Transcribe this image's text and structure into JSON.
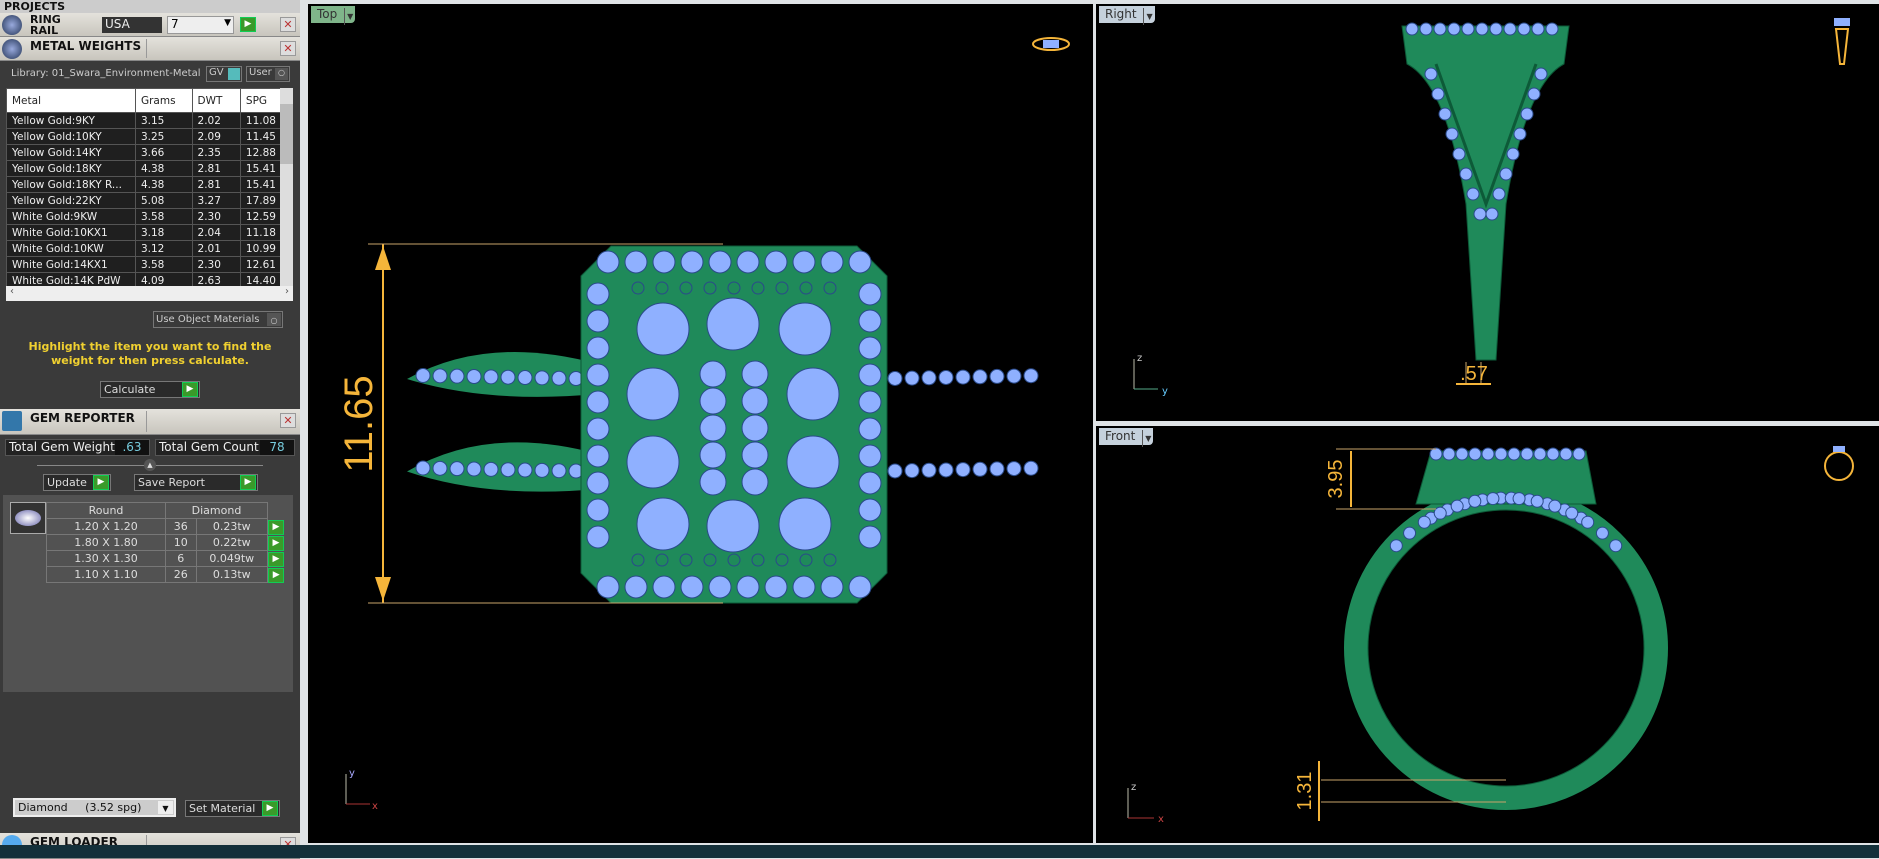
{
  "panels": {
    "projects": "PROJECTS",
    "ring_rail": {
      "title": "RING RAIL",
      "country": "USA",
      "size": "7"
    },
    "metal_weights": {
      "title": "METAL WEIGHTS",
      "library": "Library: 01_Swara_Environment-Metal",
      "gv_label": "GV",
      "user_label": "User",
      "columns": [
        "Metal",
        "Grams",
        "DWT",
        "SPG"
      ],
      "rows": [
        [
          "Yellow Gold:9KY",
          "3.15",
          "2.02",
          "11.08"
        ],
        [
          "Yellow Gold:10KY",
          "3.25",
          "2.09",
          "11.45"
        ],
        [
          "Yellow Gold:14KY",
          "3.66",
          "2.35",
          "12.88"
        ],
        [
          "Yellow Gold:18KY",
          "4.38",
          "2.81",
          "15.41"
        ],
        [
          "Yellow Gold:18KY R...",
          "4.38",
          "2.81",
          "15.41"
        ],
        [
          "Yellow Gold:22KY",
          "5.08",
          "3.27",
          "17.89"
        ],
        [
          "White Gold:9KW",
          "3.58",
          "2.30",
          "12.59"
        ],
        [
          "White Gold:10KX1",
          "3.18",
          "2.04",
          "11.18"
        ],
        [
          "White Gold:10KW",
          "3.12",
          "2.01",
          "10.99"
        ],
        [
          "White Gold:14KX1",
          "3.58",
          "2.30",
          "12.61"
        ],
        [
          "White Gold:14K PdW",
          "4.09",
          "2.63",
          "14.40"
        ]
      ],
      "use_object_materials": "Use Object Materials",
      "hint": "Highlight the item you want to find the weight for then press calculate.",
      "calculate": "Calculate"
    },
    "gem_reporter": {
      "title": "GEM REPORTER",
      "total_weight_label": "Total Gem Weight",
      "total_weight": ".63",
      "total_count_label": "Total Gem Count",
      "total_count": "78",
      "update": "Update",
      "save_report": "Save Report",
      "shape": "Round",
      "material": "Diamond",
      "rows": [
        [
          "1.20 X 1.20",
          "36",
          "0.23tw"
        ],
        [
          "1.80 X 1.80",
          "10",
          "0.22tw"
        ],
        [
          "1.30 X 1.30",
          "6",
          "0.049tw"
        ],
        [
          "1.10 X 1.10",
          "26",
          "0.13tw"
        ]
      ],
      "material_select": "Diamond     (3.52 spg)",
      "set_material": "Set Material"
    },
    "gem_loader": {
      "title": "GEM LOADER"
    }
  },
  "viewports": {
    "top": {
      "label": "Top",
      "dimension": "11.65",
      "axis_x": "x",
      "axis_y": "y"
    },
    "right": {
      "label": "Right",
      "dimension": ".57",
      "axis_x": "y",
      "axis_y": "z"
    },
    "front": {
      "label": "Front",
      "dimension_top": "3.95",
      "dimension_bottom": "1.31",
      "axis_x": "x",
      "axis_y": "z"
    }
  },
  "colors": {
    "metal": "#1f8a5a",
    "gem": "#8fb0ff",
    "dimension": "#f5b53a",
    "viewport_bg": "#000000"
  }
}
